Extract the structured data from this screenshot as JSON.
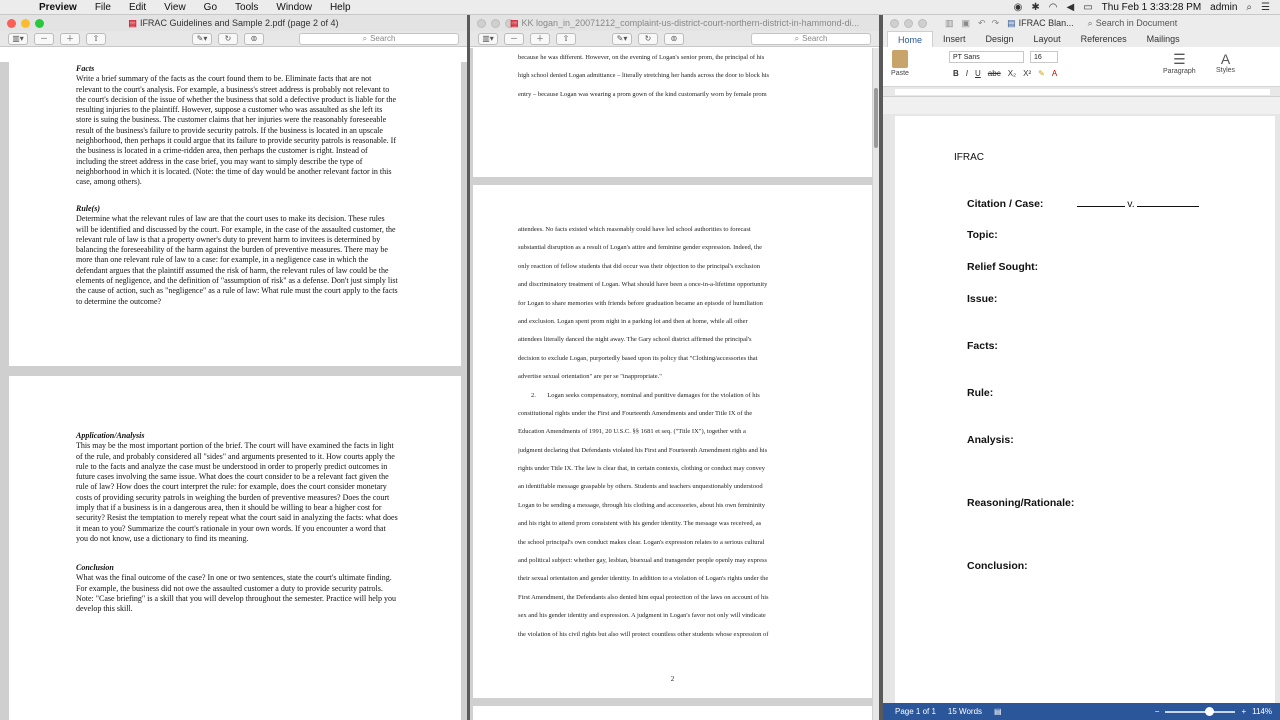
{
  "menubar": {
    "app": "Preview",
    "items": [
      "File",
      "Edit",
      "View",
      "Go",
      "Tools",
      "Window",
      "Help"
    ],
    "clock": "Thu Feb 1  3:33:28 PM",
    "user": "admin"
  },
  "preview1": {
    "title": "IFRAC Guidelines and Sample 2.pdf (page 2 of 4)",
    "search_placeholder": "Search",
    "sections": [
      {
        "heading": "Facts",
        "body": "Write a brief summary of the facts as the court found them to be. Eliminate facts that are not relevant to the court's analysis. For example, a business's street address is probably not relevant to the court's decision of the issue of whether the business that sold a defective product is liable for the resulting injuries to the plaintiff. However, suppose a customer who was assaulted as she left its store is suing the business. The customer claims that her injuries were the reasonably foreseeable result of the business's failure to provide security patrols. If the business is located in an upscale neighborhood, then perhaps it could argue that its failure to provide security patrols is reasonable. If the business is located in a crime-ridden area, then perhaps the customer is right. Instead of including the street address in the case brief, you may want to simply describe the type of neighborhood in which it is located. (Note: the time of day would be another relevant factor in this case, among others)."
      },
      {
        "heading": "Rule(s)",
        "body": "Determine what the relevant rules of law are that the court uses to make its decision. These rules will be identified and discussed by the court. For example, in the case of the assaulted customer, the relevant rule of law is that a property owner's duty to prevent harm to invitees is determined by balancing the foreseeability of the harm against the burden of preventive measures. There may be more than one relevant rule of law to a case: for example, in a negligence case in which the defendant argues that the plaintiff assumed the risk of harm, the relevant rules of law could be the elements of negligence, and the definition of \"assumption of risk\" as a defense. Don't just simply list the cause of action, such as \"negligence\" as a rule of law: What rule must the court apply to the facts to determine the outcome?"
      },
      {
        "heading": "Application/Analysis",
        "body": "This may be the most important portion of the brief. The court will have examined the facts in light of the rule, and probably considered all \"sides\" and arguments presented to it. How courts apply the rule to the facts and analyze the case must be understood in order to properly predict outcomes in future cases involving the same issue. What does the court consider to be a relevant fact given the rule of law? How does the court interpret the rule: for example, does the court consider monetary costs of providing security patrols in weighing the burden of preventive measures? Does the court imply that if a business is in a dangerous area, then it should be willing to bear a higher cost for security? Resist the temptation to merely repeat what the court said in analyzing the facts: what does it mean to you? Summarize the court's rationale in your own words. If you encounter a word that you do not know, use a dictionary to find its meaning."
      },
      {
        "heading": "Conclusion",
        "body": "What was the final outcome of the case? In one or two sentences, state the court's ultimate finding. For example, the business did not owe the assaulted customer a duty to provide security patrols.  Note: \"Case briefing\" is a skill that you will develop throughout the semester. Practice will help you develop this skill."
      }
    ]
  },
  "preview2": {
    "title": "KK logan_in_20071212_complaint-us-district-court-northern-district-in-hammond-di...",
    "search_placeholder": "Search",
    "page_top_lines": [
      "because he was different.  However, on the evening of Logan's senior prom, the principal of his",
      "high school denied Logan admittance – literally stretching her hands across the door to block his",
      "entry – because Logan was wearing a prom gown of the kind customarily worn by female prom"
    ],
    "page_main_lines": [
      "attendees.  No facts existed which reasonably could have led school authorities to forecast",
      "substantial disruption as a result of Logan's attire and feminine gender expression.  Indeed, the",
      "only reaction of fellow students that did occur was their objection to the principal's exclusion",
      "and discriminatory treatment of Logan.  What should have been a once-in-a-lifetime opportunity",
      "for Logan to share memories with friends before graduation became an episode of humiliation",
      "and exclusion.  Logan spent prom night in a parking lot and then at home, while all other",
      "attendees literally danced the night away.  The Gary school district affirmed the principal's",
      "decision to exclude Logan, purportedly based upon its policy that \"Clothing/accessories that",
      "advertise sexual orientation\" are per se \"inappropriate.\"",
      "        2.       Logan seeks compensatory, nominal and punitive damages for the violation of his",
      "constitutional rights under the First and Fourteenth Amendments and under Title IX of the",
      "Education Amendments of 1991, 20 U.S.C. §§ 1681 et seq. (\"Title IX\"), together with a",
      "judgment declaring that Defendants violated his First and Fourteenth Amendment rights and his",
      "rights under Title IX.  The law is clear that, in certain contexts, clothing or conduct may convey",
      "an identifiable message graspable by others.  Students and teachers unquestionably understood",
      "Logan to be sending a message, through his clothing and accessories, about his own femininity",
      "and his right to attend prom consistent with his gender identity.  The message was received, as",
      "the school principal's own conduct makes clear.  Logan's expression relates to a serious cultural",
      "and political subject:  whether gay, lesbian, bisexual and transgender people openly may express",
      "their sexual orientation and gender identity.  In addition to a violation of Logan's rights under the",
      "First Amendment, the Defendants also denied him equal protection of the laws on account of his",
      "sex and his gender identity and expression.  A judgment in Logan's favor not only will vindicate",
      "the violation of his civil rights but also will protect countless other students whose expression of"
    ],
    "page_number": "2"
  },
  "word": {
    "title": "IFRAC Blan...",
    "search_placeholder": "Search in Document",
    "tabs": [
      "Home",
      "Insert",
      "Design",
      "Layout",
      "References",
      "Mailings"
    ],
    "font_name": "PT Sans",
    "font_size": "16",
    "paste_label": "Paste",
    "paragraph_label": "Paragraph",
    "styles_label": "Styles",
    "doc_title": "IFRAC",
    "citation_label": "Citation / Case:",
    "citation_v": "v.",
    "fields": [
      "Topic:",
      "Relief Sought:",
      "Issue:",
      "Facts:",
      "Rule:",
      "Analysis:",
      "Reasoning/Rationale:",
      "Conclusion:"
    ],
    "status_page": "Page 1 of 1",
    "status_words": "15 Words",
    "zoom": "114%"
  }
}
